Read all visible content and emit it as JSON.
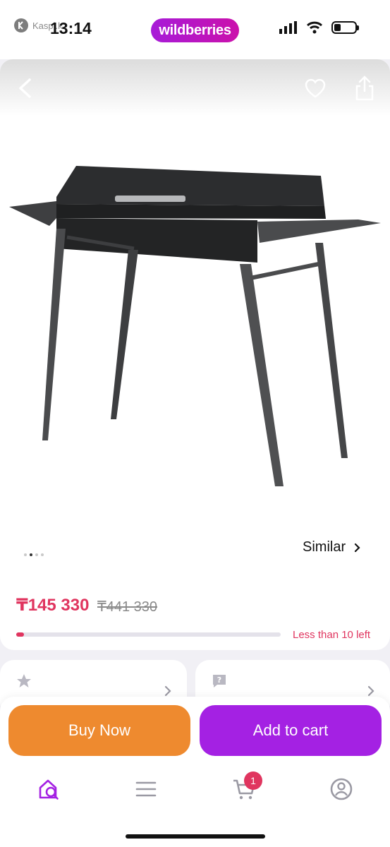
{
  "status_bar": {
    "back_app_label": "Kaspi.kz",
    "time": "13:14",
    "brand": "wildberries"
  },
  "product": {
    "similar_label": "Similar",
    "gallery": {
      "total": 4,
      "active_index": 1
    },
    "price_current": "₸145 330",
    "price_old": "₸441 330",
    "stock_label": "Less than 10 left",
    "stock_fraction": 0.03
  },
  "actions": {
    "buy_now": "Buy Now",
    "add_to_cart": "Add to cart"
  },
  "tab_bar": {
    "cart_count": "1"
  },
  "colors": {
    "accent_purple": "#a421e3",
    "buy_orange": "#ee8a2f",
    "price_red": "#e0355f"
  },
  "icons": [
    "back-icon",
    "heart-icon",
    "share-icon",
    "star-icon",
    "question-icon",
    "chevron-right-icon",
    "home-search-icon",
    "menu-icon",
    "cart-icon",
    "profile-icon"
  ]
}
